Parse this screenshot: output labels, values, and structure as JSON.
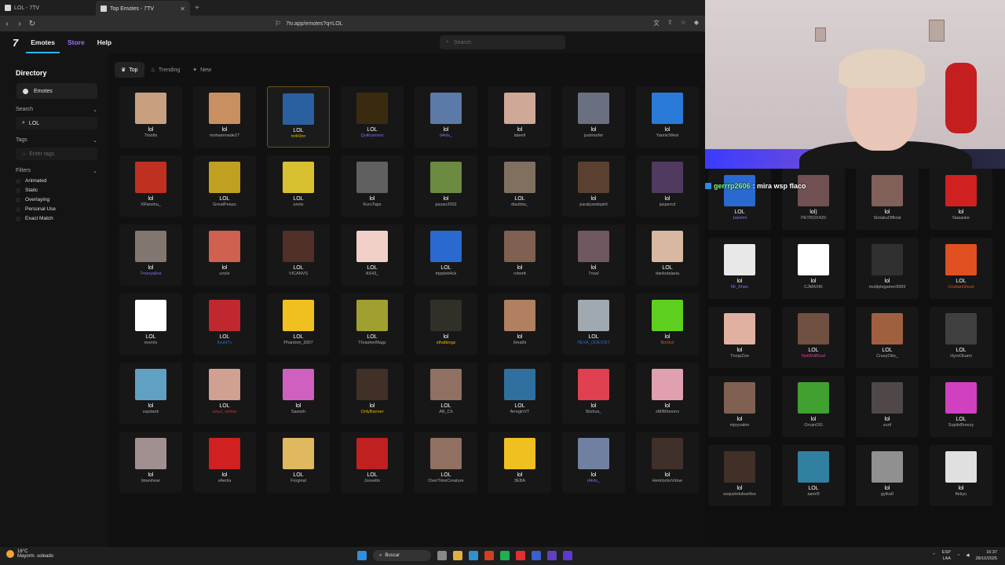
{
  "browser": {
    "tabs": [
      {
        "title": "LOL - 7TV",
        "active": false
      },
      {
        "title": "Top Emotes - 7TV",
        "active": true
      }
    ],
    "url": "7tv.app/emotes?q=LOL"
  },
  "site": {
    "logo": "7",
    "nav": [
      "Emotes",
      "Store",
      "Help"
    ],
    "search_placeholder": "Search"
  },
  "sidebar": {
    "title": "Directory",
    "item": "Emotes",
    "search_label": "Search",
    "search_value": "LOL",
    "tags_label": "Tags",
    "tags_placeholder": "Enter tags",
    "filters_label": "Filters",
    "filters": [
      "Animated",
      "Static",
      "Overlaying",
      "Personal Use",
      "Exact Match"
    ]
  },
  "sort_tabs": [
    "Top",
    "Trending",
    "New"
  ],
  "emotes": [
    {
      "name": "lol",
      "author": "Ttootts",
      "color": "#c8a080",
      "auth_color": "#aaaaaa"
    },
    {
      "name": "lol",
      "author": "mohammade27",
      "color": "#c89060",
      "auth_color": "#aaaaaa"
    },
    {
      "name": "LOL",
      "author": "m4•0nn",
      "color": "#2a5fa0",
      "auth_color": "#e6b800"
    },
    {
      "name": "LOL",
      "author": "Quilicannon",
      "color": "#3a2a10",
      "auth_color": "#8a6cff"
    },
    {
      "name": "lol",
      "author": "d4vls_",
      "color": "#5c7aa8",
      "auth_color": "#8a6cff"
    },
    {
      "name": "lol",
      "author": "lateefi",
      "color": "#d0a898",
      "auth_color": "#aaaaaa"
    },
    {
      "name": "lol",
      "author": "justmorfer",
      "color": "#6a7080",
      "auth_color": "#aaaaaa"
    },
    {
      "name": "lol",
      "author": "YannicWest",
      "color": "#2a7ad8",
      "auth_color": "#aaaaaa"
    },
    {
      "name": "lol",
      "author": "XRanshu_",
      "color": "#c03020",
      "auth_color": "#aaaaaa"
    },
    {
      "name": "LOL",
      "author": "GreatPeepo",
      "color": "#c0a020",
      "auth_color": "#aaaaaa"
    },
    {
      "name": "LOL",
      "author": "uncle",
      "color": "#d8c030",
      "auth_color": "#aaaaaa"
    },
    {
      "name": "lol",
      "author": "KuruTaps",
      "color": "#606060",
      "auth_color": "#aaaaaa"
    },
    {
      "name": "lol",
      "author": "pazan2002",
      "color": "#6c8a40",
      "auth_color": "#aaaaaa"
    },
    {
      "name": "LOL",
      "author": "diazbtw_",
      "color": "#807060",
      "auth_color": "#aaaaaa"
    },
    {
      "name": "lol",
      "author": "paralyzedspirit",
      "color": "#5a4030",
      "auth_color": "#aaaaaa"
    },
    {
      "name": "lol",
      "author": "jaspercd",
      "color": "#503a60",
      "auth_color": "#aaaaaa"
    },
    {
      "name": "lol",
      "author": "7•neryaline",
      "color": "#807870",
      "auth_color": "#8a6cff"
    },
    {
      "name": "lol",
      "author": "uncle",
      "color": "#d06050",
      "auth_color": "#aaaaaa"
    },
    {
      "name": "LOL",
      "author": "VICANVS",
      "color": "#503028",
      "auth_color": "#aaaaaa"
    },
    {
      "name": "LOL",
      "author": "AS43_",
      "color": "#f0d0c8",
      "auth_color": "#aaaaaa"
    },
    {
      "name": "LOL",
      "author": "trippleb4ck",
      "color": "#2a6ad0",
      "auth_color": "#aaaaaa"
    },
    {
      "name": "lol",
      "author": "rvbertt",
      "color": "#806050",
      "auth_color": "#aaaaaa"
    },
    {
      "name": "lol",
      "author": "7rowl",
      "color": "#705860",
      "auth_color": "#aaaaaa"
    },
    {
      "name": "LOL",
      "author": "dankotalaria",
      "color": "#d8b8a0",
      "auth_color": "#aaaaaa"
    },
    {
      "name": "LOL",
      "author": "mornis",
      "color": "#ffffff",
      "auth_color": "#aaaaaa"
    },
    {
      "name": "LOL",
      "author": "flyuktTv",
      "color": "#c02830",
      "auth_color": "#2a6ad0"
    },
    {
      "name": "LOL",
      "author": "Phantom_3007",
      "color": "#f0c020",
      "auth_color": "#aaaaaa"
    },
    {
      "name": "LOL",
      "author": "ThrasherMagz",
      "color": "#a0a030",
      "auth_color": "#aaaaaa"
    },
    {
      "name": "lol",
      "author": "xthatkingz",
      "color": "#303028",
      "auth_color": "#e6b800"
    },
    {
      "name": "lol",
      "author": "6mathi",
      "color": "#b08060",
      "auth_color": "#aaaaaa"
    },
    {
      "name": "LOL",
      "author": "ЛЕХА_ODESSIT",
      "color": "#a0a8b0",
      "auth_color": "#2a6ad0"
    },
    {
      "name": "lol",
      "author": "Bonkol",
      "color": "#60d020",
      "auth_color": "#e05020"
    },
    {
      "name": "lol",
      "author": "zaydank",
      "color": "#60a0c0",
      "auth_color": "#aaaaaa"
    },
    {
      "name": "LOL",
      "author": "илья_чебов",
      "color": "#d0a090",
      "auth_color": "#d03030"
    },
    {
      "name": "lol",
      "author": "Sasseh",
      "color": "#d060c0",
      "auth_color": "#aaaaaa"
    },
    {
      "name": "lol",
      "author": "OnlyBanner",
      "color": "#403028",
      "auth_color": "#e6b800"
    },
    {
      "name": "LOL",
      "author": "Alli_Ch",
      "color": "#907060",
      "auth_color": "#aaaaaa"
    },
    {
      "name": "LOL",
      "author": "ArreginVT",
      "color": "#3070a0",
      "auth_color": "#aaaaaa"
    },
    {
      "name": "lol",
      "author": "Slivirus_",
      "color": "#e04050",
      "auth_color": "#aaaaaa"
    },
    {
      "name": "lol",
      "author": "xMIMInnnnx",
      "color": "#e0a0b0",
      "auth_color": "#aaaaaa"
    },
    {
      "name": "lol",
      "author": "timeshear",
      "color": "#a09090",
      "auth_color": "#aaaaaa"
    },
    {
      "name": "lol",
      "author": "xAeriia",
      "color": "#d02020",
      "auth_color": "#aaaaaa"
    },
    {
      "name": "LOL",
      "author": "Forginal",
      "color": "#e0b860",
      "auth_color": "#aaaaaa"
    },
    {
      "name": "LOL",
      "author": "Josvelto",
      "color": "#c02020",
      "auth_color": "#aaaaaa"
    },
    {
      "name": "LOL",
      "author": "OverTimeCreature",
      "color": "#907060",
      "auth_color": "#aaaaaa"
    },
    {
      "name": "lol",
      "author": "3EBA",
      "color": "#f0c020",
      "auth_color": "#aaaaaa"
    },
    {
      "name": "lol",
      "author": "d4vls_",
      "color": "#7080a0",
      "auth_color": "#8a6cff"
    },
    {
      "name": "lol",
      "author": "HemlocksVirtue",
      "color": "#40302a",
      "auth_color": "#aaaaaa"
    }
  ],
  "right_emotes": [
    {
      "name": "LOL",
      "author": "Jakelmi",
      "color": "#2a6ad0",
      "auth_color": "#8a6cff"
    },
    {
      "name": "lol)",
      "author": "PETROX420",
      "color": "#705050",
      "auth_color": "#aaaaaa"
    },
    {
      "name": "lol",
      "author": "SintakuOfficial",
      "color": "#806058",
      "auth_color": "#aaaaaa"
    },
    {
      "name": "lol",
      "author": "Naaaske",
      "color": "#d02020",
      "auth_color": "#aaaaaa"
    },
    {
      "name": "lol",
      "author": "Mr_Khan",
      "color": "#e8e8e8",
      "auth_color": "#8a6cff"
    },
    {
      "name": "lol",
      "author": "CJMAXIK",
      "color": "#ffffff",
      "auth_color": "#aaaaaa"
    },
    {
      "name": "lol",
      "author": "multiplegamer9999",
      "color": "#303030",
      "auth_color": "#aaaaaa"
    },
    {
      "name": "LOL",
      "author": "CristianGhost",
      "color": "#e05020",
      "auth_color": "#e05020"
    },
    {
      "name": "lol",
      "author": "TroopZon",
      "color": "#e0b0a0",
      "auth_color": "#aaaaaa"
    },
    {
      "name": "LOL",
      "author": "NotWolfGod",
      "color": "#705040",
      "auth_color": "#e040a0"
    },
    {
      "name": "LOL",
      "author": "CrazyOtto_",
      "color": "#a06040",
      "auth_color": "#aaaaaa"
    },
    {
      "name": "LOL",
      "author": "HyroOkami",
      "color": "#404040",
      "auth_color": "#aaaaaa"
    },
    {
      "name": "lol",
      "author": "mjoyvalen",
      "color": "#806050",
      "auth_color": "#aaaaaa"
    },
    {
      "name": "lol",
      "author": "OrcanOG",
      "color": "#40a030",
      "auth_color": "#aaaaaa"
    },
    {
      "name": "lol",
      "author": "zunf",
      "color": "#504848",
      "auth_color": "#aaaaaa"
    },
    {
      "name": "LOL",
      "author": "SupitsBreezy",
      "color": "#d040c0",
      "auth_color": "#aaaaaa"
    },
    {
      "name": "lol",
      "author": "esquelotobuefixe",
      "color": "#403028",
      "auth_color": "#aaaaaa"
    },
    {
      "name": "LOL",
      "author": "aarnl9",
      "color": "#3080a0",
      "auth_color": "#aaaaaa"
    },
    {
      "name": "lol",
      "author": "gytka0",
      "color": "#909090",
      "auth_color": "#aaaaaa"
    },
    {
      "name": "lol",
      "author": "flekyu",
      "color": "#e0e0e0",
      "auth_color": "#aaaaaa"
    }
  ],
  "chat": {
    "user": "gerrrp2606",
    "message": ": mira wsp flaco"
  },
  "taskbar": {
    "temp": "16°C",
    "weather": "Mayorm. soleado",
    "search": "Buscar",
    "lang": "ESP",
    "lang2": "LAA",
    "time": "16:37",
    "date": "28/10/2025"
  }
}
